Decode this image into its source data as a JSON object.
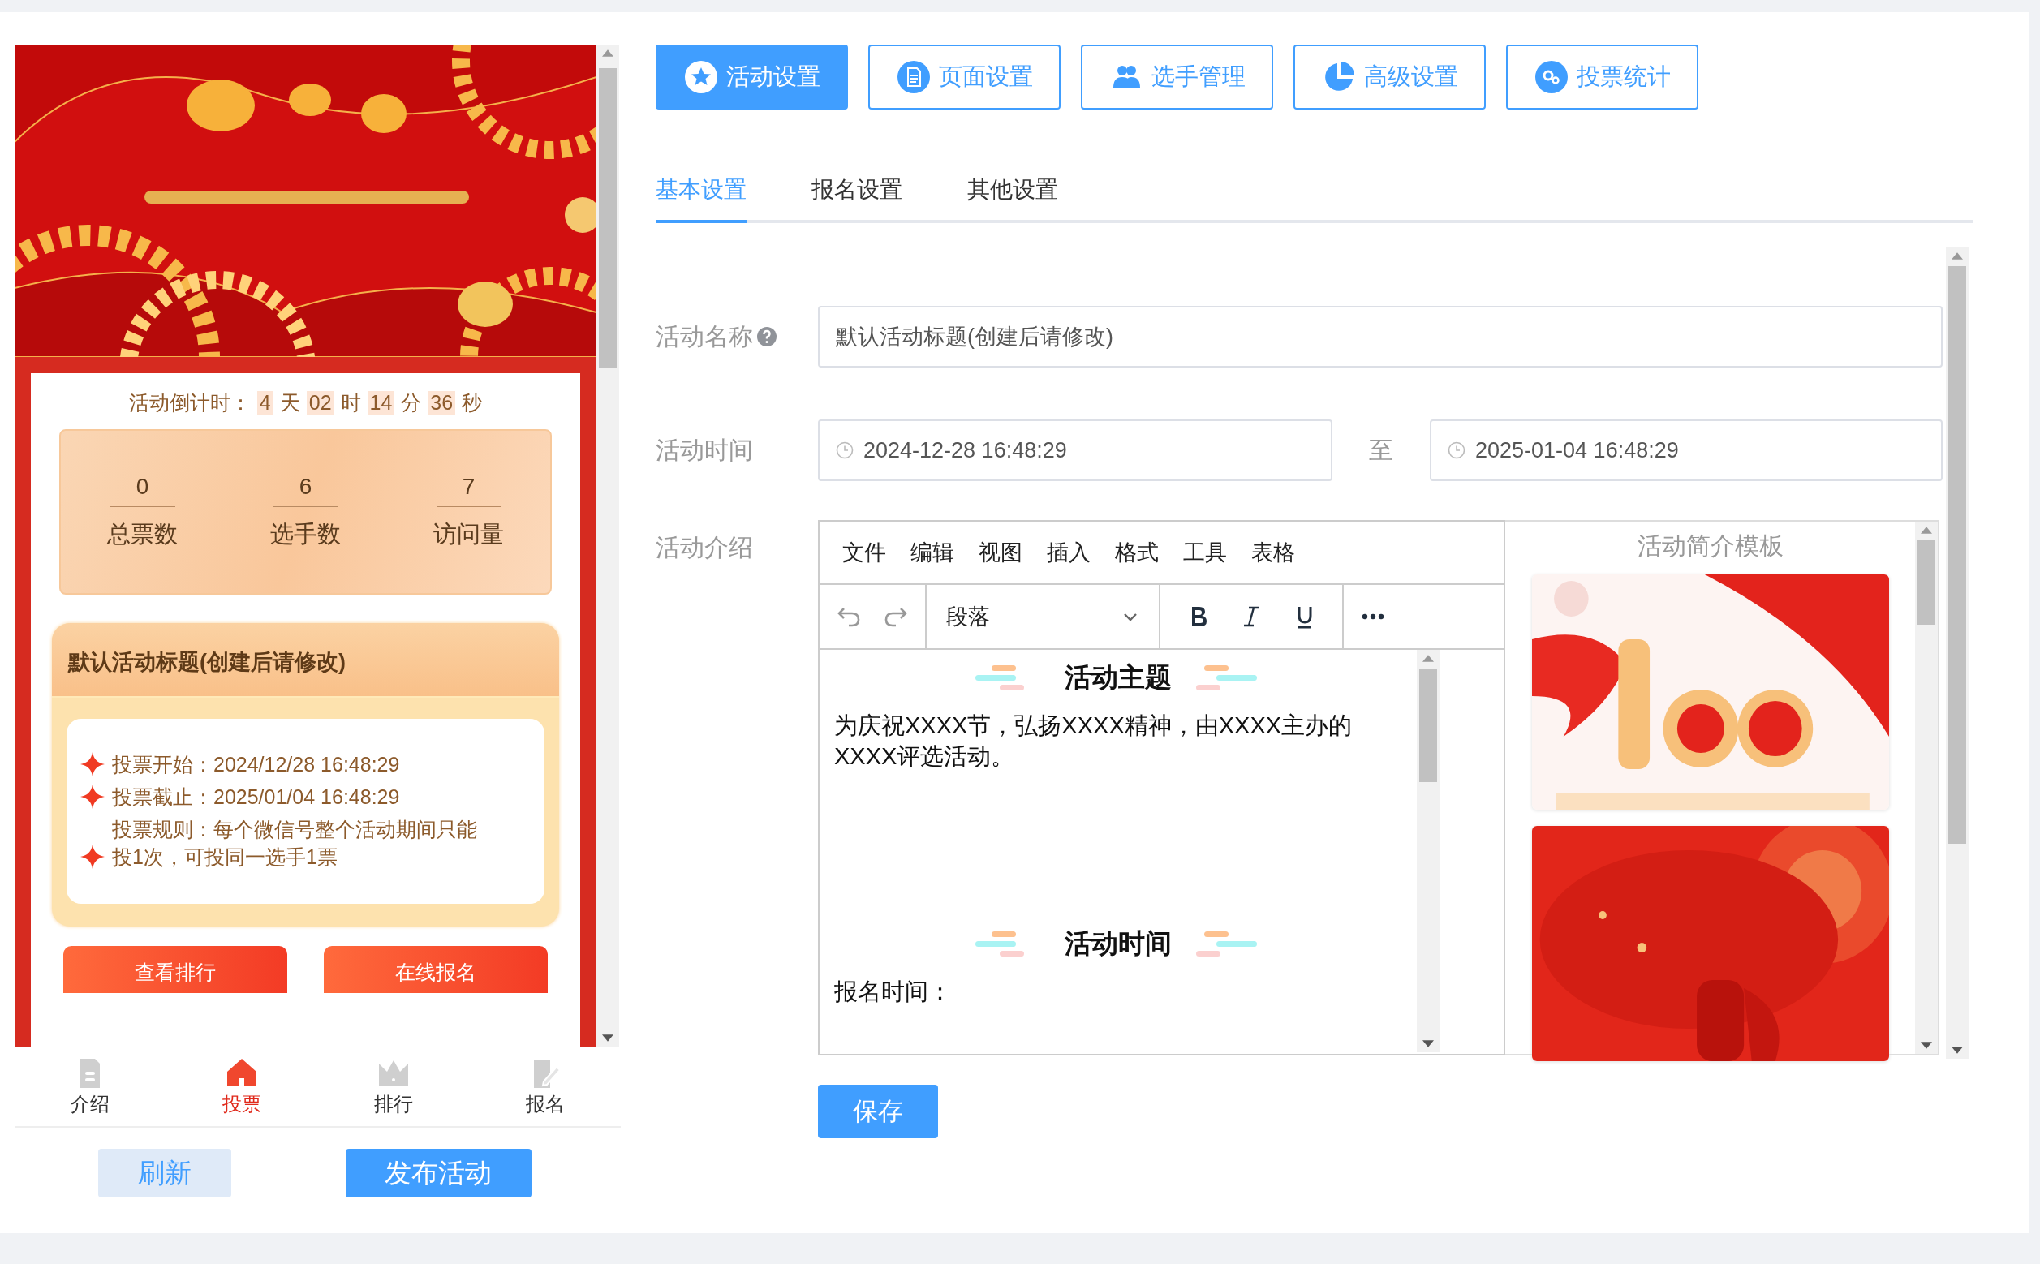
{
  "preview": {
    "banner": {
      "kind": "picture"
    },
    "countdown": {
      "label": "活动倒计时：",
      "parts": [
        {
          "value": "4",
          "unit": "天"
        },
        {
          "value": "02",
          "unit": "时"
        },
        {
          "value": "14",
          "unit": "分"
        },
        {
          "value": "36",
          "unit": "秒"
        }
      ]
    },
    "stats": [
      {
        "value": "0",
        "label": "总票数"
      },
      {
        "value": "6",
        "label": "选手数"
      },
      {
        "value": "7",
        "label": "访问量"
      }
    ],
    "info_card": {
      "title": "默认活动标题(创建后请修改)",
      "rules": [
        "投票开始：2024/12/28 16:48:29",
        "投票截止：2025/01/04 16:48:29",
        "投票规则：每个微信号整个活动期间只能投1次，可投同一选手1票"
      ]
    },
    "action_buttons": [
      "查看排行",
      "在线报名"
    ],
    "nav": [
      {
        "label": "介绍",
        "selected": false
      },
      {
        "label": "投票",
        "selected": true
      },
      {
        "label": "排行",
        "selected": false
      },
      {
        "label": "报名",
        "selected": false
      }
    ]
  },
  "preview_buttons": [
    {
      "label": "刷新",
      "kind": "secondary"
    },
    {
      "label": "发布活动",
      "kind": "primary"
    }
  ],
  "main_tabs": [
    {
      "label": "活动设置",
      "selected": true
    },
    {
      "label": "页面设置",
      "selected": false
    },
    {
      "label": "选手管理",
      "selected": false
    },
    {
      "label": "高级设置",
      "selected": false
    },
    {
      "label": "投票统计",
      "selected": false
    }
  ],
  "sub_tabs": [
    {
      "label": "基本设置",
      "selected": true
    },
    {
      "label": "报名设置",
      "selected": false
    },
    {
      "label": "其他设置",
      "selected": false
    }
  ],
  "form": {
    "name_label": "活动名称",
    "name_value": "默认活动标题(创建后请修改)",
    "time_label": "活动时间",
    "start": "2024-12-28 16:48:29",
    "separator": "至",
    "end": "2025-01-04 16:48:29",
    "intro_label": "活动介绍"
  },
  "editor": {
    "menu": [
      "文件",
      "编辑",
      "视图",
      "插入",
      "格式",
      "工具",
      "表格"
    ],
    "format": "段落",
    "content": [
      {
        "kind": "heading",
        "text": "活动主题"
      },
      {
        "kind": "paragraph",
        "text": "为庆祝XXXX节，弘扬XXXX精神，由XXXX主办的XXXX评选活动。"
      },
      {
        "kind": "heading",
        "text": "活动时间"
      },
      {
        "kind": "paragraph",
        "text": "报名时间："
      }
    ]
  },
  "templates": {
    "title": "活动简介模板",
    "items": [
      {
        "kind": "picture"
      },
      {
        "kind": "picture"
      }
    ]
  },
  "save_button": "保存"
}
